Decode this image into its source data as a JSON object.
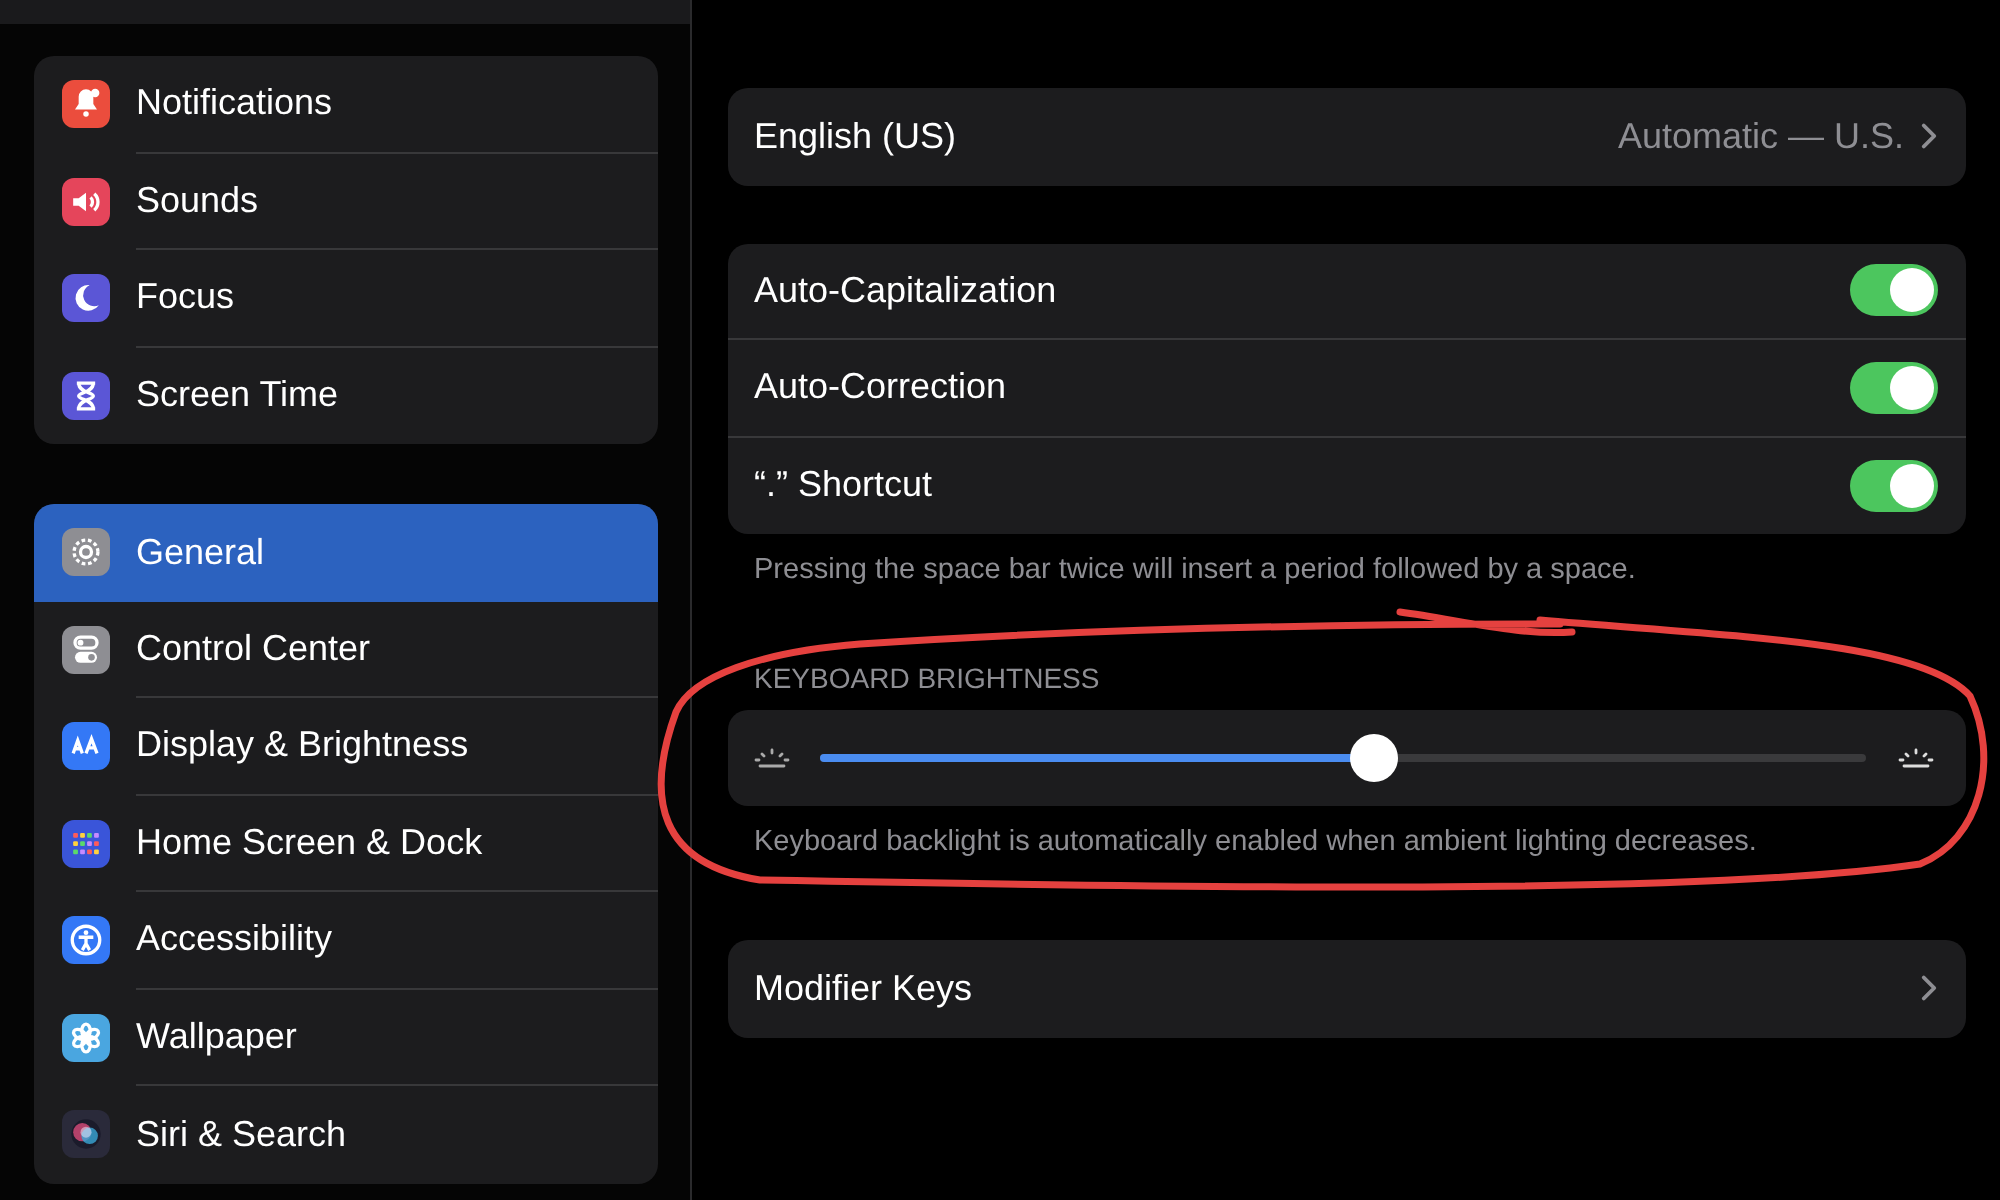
{
  "sidebar": {
    "groups": [
      {
        "items": [
          {
            "label": "Notifications",
            "color": "#eb4d3d",
            "selected": false
          },
          {
            "label": "Sounds",
            "color": "#e5455b",
            "selected": false
          },
          {
            "label": "Focus",
            "color": "#5b56d6",
            "selected": false
          },
          {
            "label": "Screen Time",
            "color": "#5b56d6",
            "selected": false
          }
        ]
      },
      {
        "items": [
          {
            "label": "General",
            "color": "#8e8e93",
            "selected": true
          },
          {
            "label": "Control Center",
            "color": "#8e8e93",
            "selected": false
          },
          {
            "label": "Display & Brightness",
            "color": "#3478f6",
            "selected": false
          },
          {
            "label": "Home Screen & Dock",
            "color": "#3a55d9",
            "selected": false
          },
          {
            "label": "Accessibility",
            "color": "#3478f6",
            "selected": false
          },
          {
            "label": "Wallpaper",
            "color": "#4aa6e0",
            "selected": false
          },
          {
            "label": "Siri & Search",
            "color": "#2a2a3a",
            "selected": false
          }
        ]
      }
    ]
  },
  "language": {
    "label": "English (US)",
    "value": "Automatic — U.S."
  },
  "toggles": [
    {
      "label": "Auto-Capitalization",
      "on": true
    },
    {
      "label": "Auto-Correction",
      "on": true
    },
    {
      "label": "“.” Shortcut",
      "on": true
    }
  ],
  "toggles_footer": "Pressing the space bar twice will insert a period followed by a space.",
  "brightness": {
    "header": "KEYBOARD BRIGHTNESS",
    "level": 0.53,
    "footer": "Keyboard backlight is automatically enabled when ambient lighting decreases."
  },
  "modifier_keys": {
    "label": "Modifier Keys"
  }
}
